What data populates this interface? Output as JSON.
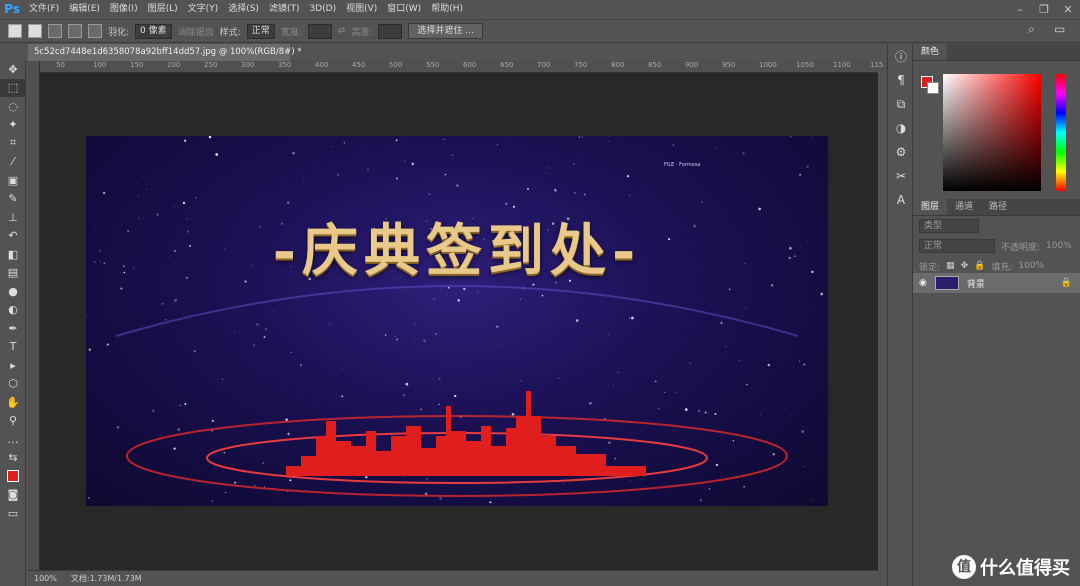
{
  "app": {
    "logo": "Ps"
  },
  "menubar": {
    "items": [
      "文件(F)",
      "编辑(E)",
      "图像(I)",
      "图层(L)",
      "文字(Y)",
      "选择(S)",
      "滤镜(T)",
      "3D(D)",
      "视图(V)",
      "窗口(W)",
      "帮助(H)"
    ],
    "window_controls": [
      "minimize-icon",
      "maximize-icon",
      "close-icon"
    ]
  },
  "options": {
    "feather_label": "羽化:",
    "feather_value": "0 像素",
    "antialias_label": "消除锯齿",
    "style_label": "样式:",
    "style_value": "正常",
    "width_label": "宽度:",
    "height_label": "高度:",
    "select_mask_button": "选择并遮住 ..."
  },
  "document": {
    "tab_title": "5c52cd7448e1d6358078a92bff14dd57.jpg @ 100%(RGB/8#) *",
    "ruler_ticks": [
      "50",
      "100",
      "150",
      "200",
      "250",
      "300",
      "350",
      "400",
      "450",
      "500",
      "550",
      "600",
      "650",
      "700",
      "750",
      "800",
      "850",
      "900",
      "950",
      "1000",
      "1050",
      "1100",
      "115"
    ]
  },
  "image": {
    "title": "-庆典签到处-",
    "logo_text": "FILE · Formosa"
  },
  "status": {
    "zoom": "100%",
    "doc": "文档:1.73M/1.73M"
  },
  "panels": {
    "color": {
      "tab": "颜色",
      "fg": "#e02020",
      "bg": "#ffffff"
    },
    "layers": {
      "tabs": [
        "图层",
        "通道",
        "路径"
      ],
      "filter_placeholder": "类型",
      "blend_mode": "正常",
      "opacity_label": "不透明度:",
      "opacity_value": "100%",
      "lock_label": "锁定:",
      "fill_label": "填充:",
      "fill_value": "100%",
      "layer_name": "背景"
    }
  },
  "watermark": {
    "text": "什么值得买",
    "icon": "值"
  }
}
